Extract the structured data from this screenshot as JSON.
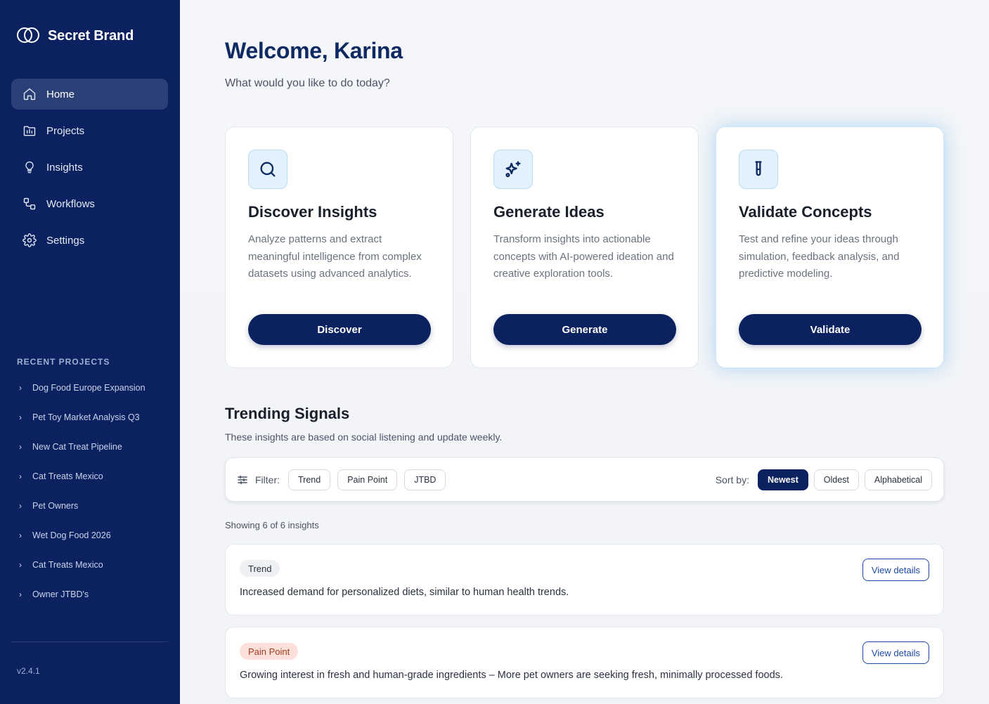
{
  "brand": {
    "name": "Secret Brand"
  },
  "nav": [
    {
      "label": "Home",
      "icon": "home-icon",
      "active": true
    },
    {
      "label": "Projects",
      "icon": "projects-icon"
    },
    {
      "label": "Insights",
      "icon": "lightbulb-icon"
    },
    {
      "label": "Workflows",
      "icon": "workflow-icon"
    },
    {
      "label": "Settings",
      "icon": "gear-icon"
    }
  ],
  "recent": {
    "title": "RECENT PROJECTS",
    "items": [
      "Dog Food Europe Expansion",
      "Pet Toy Market Analysis Q3",
      "New Cat Treat Pipeline",
      "Cat Treats Mexico",
      "Pet Owners",
      "Wet Dog Food 2026",
      "Cat Treats Mexico",
      "Owner JTBD's"
    ]
  },
  "version": "v2.4.1",
  "header": {
    "title": "Welcome, Karina",
    "subtitle": "What would you like to do today?"
  },
  "cards": [
    {
      "icon": "search-icon",
      "title": "Discover Insights",
      "description": "Analyze patterns and extract meaningful intelligence from complex datasets using advanced analytics.",
      "button": "Discover"
    },
    {
      "icon": "sparkles-icon",
      "title": "Generate Ideas",
      "description": "Transform insights into actionable concepts with AI-powered ideation and creative exploration tools.",
      "button": "Generate"
    },
    {
      "icon": "test-tube-icon",
      "title": "Validate Concepts",
      "description": "Test and refine your ideas through simulation, feedback analysis, and predictive modeling.",
      "button": "Validate"
    }
  ],
  "trending": {
    "title": "Trending Signals",
    "subtitle": "These insights are based on social listening and update weekly.",
    "filter_label": "Filter:",
    "filters": [
      "Trend",
      "Pain Point",
      "JTBD"
    ],
    "sort_label": "Sort by:",
    "sorts": [
      "Newest",
      "Oldest",
      "Alphabetical"
    ],
    "active_sort": "Newest",
    "showing": "Showing 6 of 6 insights",
    "items": [
      {
        "tag": "Trend",
        "tag_color": "#eef0f3",
        "text": "Increased demand for personalized diets, similar to human health trends.",
        "action": "View details"
      },
      {
        "tag": "Pain Point",
        "tag_color": "#fde0d9",
        "text": "Growing interest in fresh and human-grade ingredients – More pet owners are seeking fresh, minimally processed foods.",
        "action": "View details"
      }
    ]
  },
  "colors": {
    "sidebar": "#0c2260",
    "primary": "#0c2260",
    "accent_blue": "#1e4aa0",
    "card_icon_bg": "#e2f1fb"
  }
}
